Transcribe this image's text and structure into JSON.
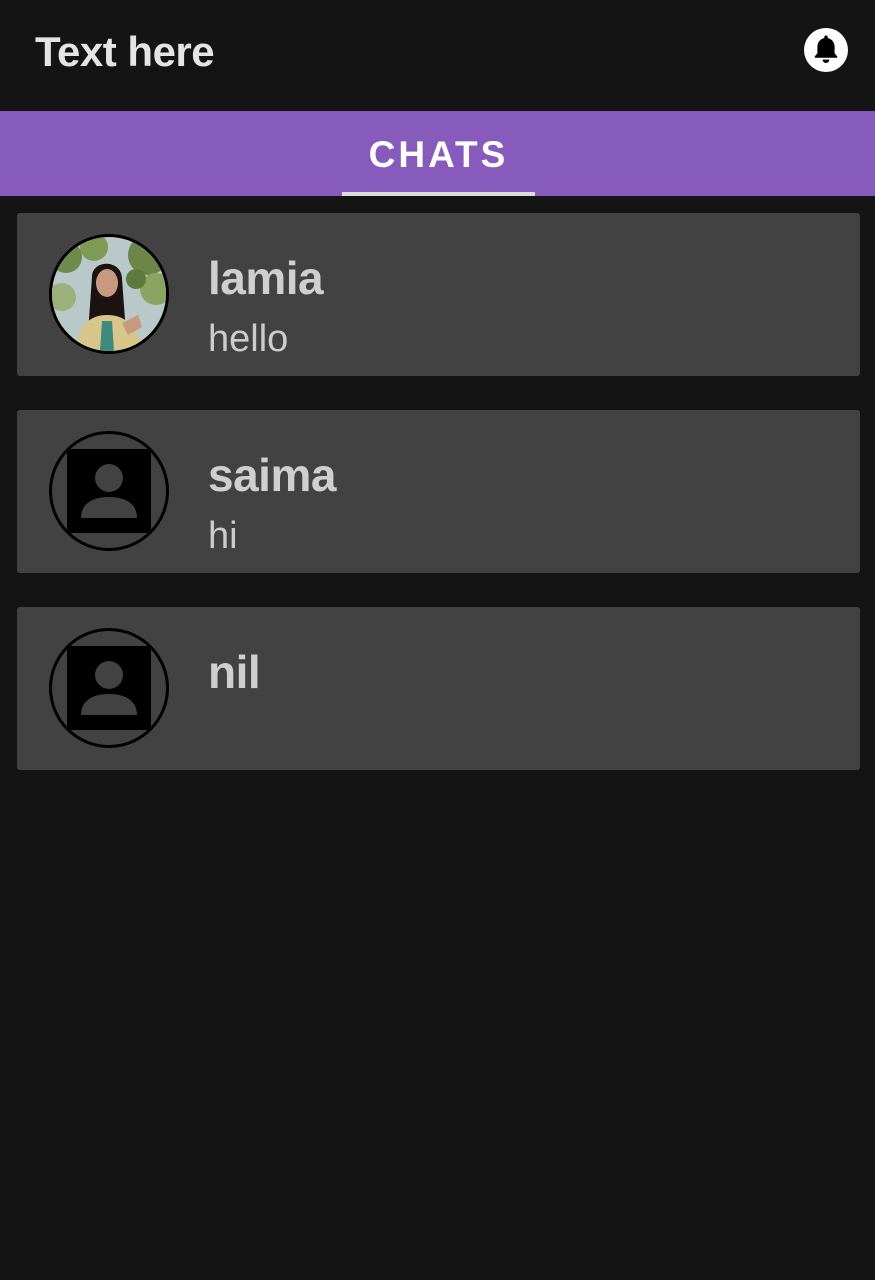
{
  "header": {
    "title": "Text here",
    "notification_icon": "bell-icon"
  },
  "tabs": [
    {
      "label": "CHATS",
      "active": true
    }
  ],
  "colors": {
    "background": "#141414",
    "tab_bar": "#875bbb",
    "card": "#424242",
    "text_primary": "#cfcfcf"
  },
  "chats": [
    {
      "name": "lamia",
      "last_message": "hello",
      "avatar": "user-photo"
    },
    {
      "name": "saima",
      "last_message": "hi",
      "avatar": "default-avatar-icon"
    },
    {
      "name": "nil",
      "last_message": "",
      "avatar": "default-avatar-icon"
    }
  ]
}
